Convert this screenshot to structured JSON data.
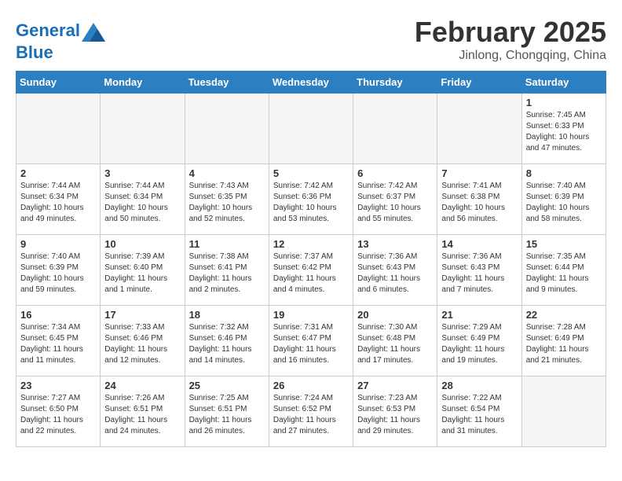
{
  "header": {
    "logo_line1": "General",
    "logo_line2": "Blue",
    "month": "February 2025",
    "location": "Jinlong, Chongqing, China"
  },
  "weekdays": [
    "Sunday",
    "Monday",
    "Tuesday",
    "Wednesday",
    "Thursday",
    "Friday",
    "Saturday"
  ],
  "weeks": [
    [
      {
        "day": "",
        "info": ""
      },
      {
        "day": "",
        "info": ""
      },
      {
        "day": "",
        "info": ""
      },
      {
        "day": "",
        "info": ""
      },
      {
        "day": "",
        "info": ""
      },
      {
        "day": "",
        "info": ""
      },
      {
        "day": "1",
        "info": "Sunrise: 7:45 AM\nSunset: 6:33 PM\nDaylight: 10 hours and 47 minutes."
      }
    ],
    [
      {
        "day": "2",
        "info": "Sunrise: 7:44 AM\nSunset: 6:34 PM\nDaylight: 10 hours and 49 minutes."
      },
      {
        "day": "3",
        "info": "Sunrise: 7:44 AM\nSunset: 6:34 PM\nDaylight: 10 hours and 50 minutes."
      },
      {
        "day": "4",
        "info": "Sunrise: 7:43 AM\nSunset: 6:35 PM\nDaylight: 10 hours and 52 minutes."
      },
      {
        "day": "5",
        "info": "Sunrise: 7:42 AM\nSunset: 6:36 PM\nDaylight: 10 hours and 53 minutes."
      },
      {
        "day": "6",
        "info": "Sunrise: 7:42 AM\nSunset: 6:37 PM\nDaylight: 10 hours and 55 minutes."
      },
      {
        "day": "7",
        "info": "Sunrise: 7:41 AM\nSunset: 6:38 PM\nDaylight: 10 hours and 56 minutes."
      },
      {
        "day": "8",
        "info": "Sunrise: 7:40 AM\nSunset: 6:39 PM\nDaylight: 10 hours and 58 minutes."
      }
    ],
    [
      {
        "day": "9",
        "info": "Sunrise: 7:40 AM\nSunset: 6:39 PM\nDaylight: 10 hours and 59 minutes."
      },
      {
        "day": "10",
        "info": "Sunrise: 7:39 AM\nSunset: 6:40 PM\nDaylight: 11 hours and 1 minute."
      },
      {
        "day": "11",
        "info": "Sunrise: 7:38 AM\nSunset: 6:41 PM\nDaylight: 11 hours and 2 minutes."
      },
      {
        "day": "12",
        "info": "Sunrise: 7:37 AM\nSunset: 6:42 PM\nDaylight: 11 hours and 4 minutes."
      },
      {
        "day": "13",
        "info": "Sunrise: 7:36 AM\nSunset: 6:43 PM\nDaylight: 11 hours and 6 minutes."
      },
      {
        "day": "14",
        "info": "Sunrise: 7:36 AM\nSunset: 6:43 PM\nDaylight: 11 hours and 7 minutes."
      },
      {
        "day": "15",
        "info": "Sunrise: 7:35 AM\nSunset: 6:44 PM\nDaylight: 11 hours and 9 minutes."
      }
    ],
    [
      {
        "day": "16",
        "info": "Sunrise: 7:34 AM\nSunset: 6:45 PM\nDaylight: 11 hours and 11 minutes."
      },
      {
        "day": "17",
        "info": "Sunrise: 7:33 AM\nSunset: 6:46 PM\nDaylight: 11 hours and 12 minutes."
      },
      {
        "day": "18",
        "info": "Sunrise: 7:32 AM\nSunset: 6:46 PM\nDaylight: 11 hours and 14 minutes."
      },
      {
        "day": "19",
        "info": "Sunrise: 7:31 AM\nSunset: 6:47 PM\nDaylight: 11 hours and 16 minutes."
      },
      {
        "day": "20",
        "info": "Sunrise: 7:30 AM\nSunset: 6:48 PM\nDaylight: 11 hours and 17 minutes."
      },
      {
        "day": "21",
        "info": "Sunrise: 7:29 AM\nSunset: 6:49 PM\nDaylight: 11 hours and 19 minutes."
      },
      {
        "day": "22",
        "info": "Sunrise: 7:28 AM\nSunset: 6:49 PM\nDaylight: 11 hours and 21 minutes."
      }
    ],
    [
      {
        "day": "23",
        "info": "Sunrise: 7:27 AM\nSunset: 6:50 PM\nDaylight: 11 hours and 22 minutes."
      },
      {
        "day": "24",
        "info": "Sunrise: 7:26 AM\nSunset: 6:51 PM\nDaylight: 11 hours and 24 minutes."
      },
      {
        "day": "25",
        "info": "Sunrise: 7:25 AM\nSunset: 6:51 PM\nDaylight: 11 hours and 26 minutes."
      },
      {
        "day": "26",
        "info": "Sunrise: 7:24 AM\nSunset: 6:52 PM\nDaylight: 11 hours and 27 minutes."
      },
      {
        "day": "27",
        "info": "Sunrise: 7:23 AM\nSunset: 6:53 PM\nDaylight: 11 hours and 29 minutes."
      },
      {
        "day": "28",
        "info": "Sunrise: 7:22 AM\nSunset: 6:54 PM\nDaylight: 11 hours and 31 minutes."
      },
      {
        "day": "",
        "info": ""
      }
    ]
  ]
}
